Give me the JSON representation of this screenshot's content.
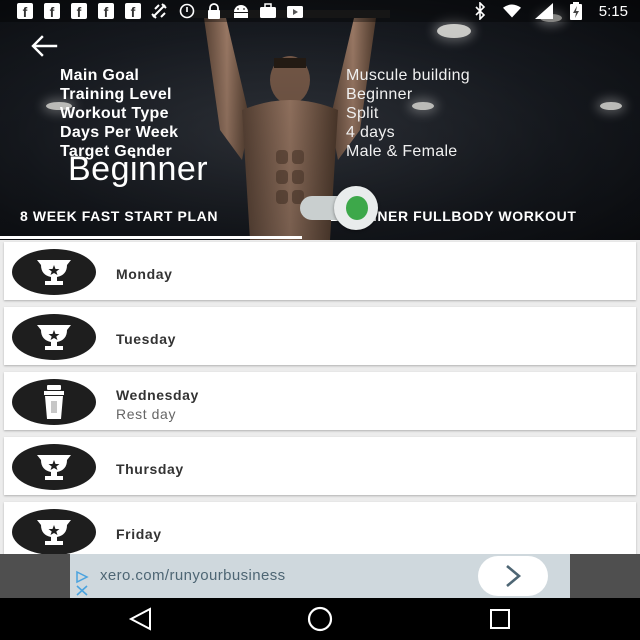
{
  "status_bar": {
    "left_icons": [
      "facebook-icon",
      "facebook-icon",
      "facebook-icon",
      "facebook-icon",
      "facebook-icon",
      "fitness-icon",
      "alarm-icon",
      "lock-icon",
      "android-icon",
      "briefcase-icon",
      "play-store-icon"
    ],
    "fb_glyph": "f",
    "time": "5:15"
  },
  "hero": {
    "info": [
      {
        "label": "Main Goal",
        "value": "Muscule building"
      },
      {
        "label": "Training Level",
        "value": "Beginner"
      },
      {
        "label": "Workout Type",
        "value": "Split"
      },
      {
        "label": "Days Per Week",
        "value": "4 days"
      },
      {
        "label": "Target Gender",
        "value": "Male & Female"
      }
    ],
    "level_title": "Beginner",
    "tabs": [
      {
        "label": "8 WEEK FAST START PLAN",
        "selected": true
      },
      {
        "label": "BEGINNER FULLBODY WORKOUT",
        "selected": false
      }
    ],
    "toggle_on": true,
    "accent_color": "#3da84a"
  },
  "days": [
    {
      "day": "Monday",
      "sub": "",
      "icon": "trophy-icon"
    },
    {
      "day": "Tuesday",
      "sub": "",
      "icon": "trophy-icon"
    },
    {
      "day": "Wednesday",
      "sub": "Rest day",
      "icon": "shaker-bottle-icon"
    },
    {
      "day": "Thursday",
      "sub": "",
      "icon": "trophy-icon"
    },
    {
      "day": "Friday",
      "sub": "",
      "icon": "trophy-icon"
    }
  ],
  "ad": {
    "url": "xero.com/runyourbusiness",
    "button_icon": "chevron-right-icon"
  },
  "nav": [
    "back-icon",
    "home-icon",
    "recents-icon"
  ]
}
